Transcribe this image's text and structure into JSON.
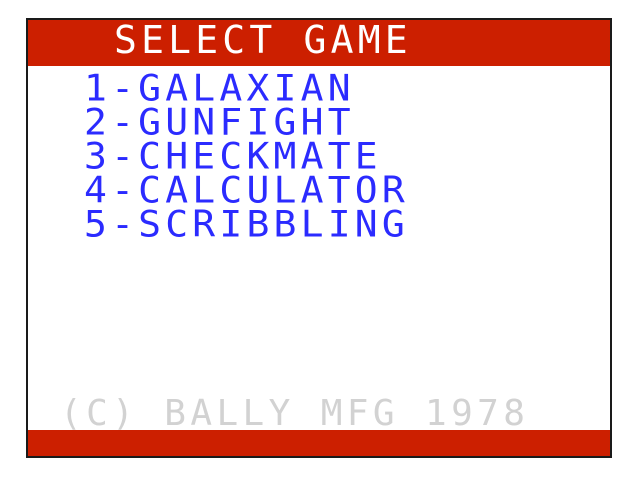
{
  "screen": {
    "title": "SELECT GAME",
    "menu": [
      {
        "label": "1-GALAXIAN"
      },
      {
        "label": "2-GUNFIGHT"
      },
      {
        "label": "3-CHECKMATE"
      },
      {
        "label": "4-CALCULATOR"
      },
      {
        "label": "5-SCRIBBLING"
      }
    ],
    "copyright": "(C) BALLY MFG 1978"
  },
  "colors": {
    "bar": "#cc1f00",
    "title_text": "#ffffff",
    "menu_text": "#2b2bff",
    "copyright_text": "#d2d2d2",
    "background": "#ffffff"
  }
}
